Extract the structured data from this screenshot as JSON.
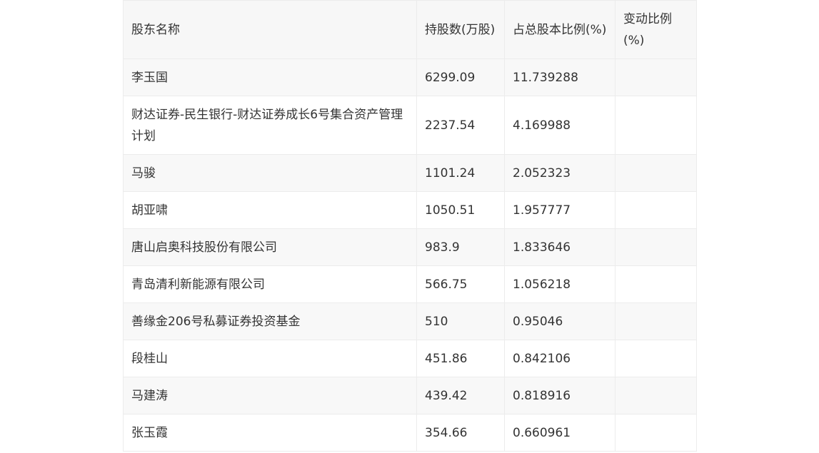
{
  "table": {
    "headers": {
      "name": "股东名称",
      "shares": "持股数(万股)",
      "ratio": "占总股本比例(%)",
      "change": "变动比例(%)"
    },
    "rows": [
      {
        "name": "李玉国",
        "shares": "6299.09",
        "ratio": "11.739288",
        "change": ""
      },
      {
        "name": "财达证券-民生银行-财达证券成长6号集合资产管理计划",
        "shares": "2237.54",
        "ratio": "4.169988",
        "change": ""
      },
      {
        "name": "马骏",
        "shares": "1101.24",
        "ratio": "2.052323",
        "change": ""
      },
      {
        "name": "胡亚啸",
        "shares": "1050.51",
        "ratio": "1.957777",
        "change": ""
      },
      {
        "name": "唐山启奥科技股份有限公司",
        "shares": "983.9",
        "ratio": "1.833646",
        "change": ""
      },
      {
        "name": "青岛清利新能源有限公司",
        "shares": "566.75",
        "ratio": "1.056218",
        "change": ""
      },
      {
        "name": "善缘金206号私募证券投资基金",
        "shares": "510",
        "ratio": "0.95046",
        "change": ""
      },
      {
        "name": "段桂山",
        "shares": "451.86",
        "ratio": "0.842106",
        "change": ""
      },
      {
        "name": "马建涛",
        "shares": "439.42",
        "ratio": "0.818916",
        "change": ""
      },
      {
        "name": "张玉霞",
        "shares": "354.66",
        "ratio": "0.660961",
        "change": ""
      }
    ]
  }
}
